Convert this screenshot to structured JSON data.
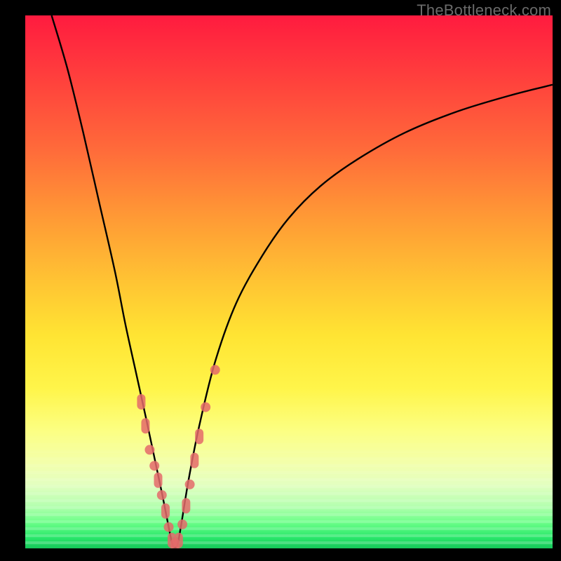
{
  "watermark": "TheBottleneck.com",
  "colors": {
    "background": "#000000",
    "curve": "#000000",
    "marker": "#e46a6a"
  },
  "chart_data": {
    "type": "line",
    "title": "",
    "xlabel": "",
    "ylabel": "",
    "xlim": [
      0,
      100
    ],
    "ylim": [
      0,
      100
    ],
    "grid": false,
    "legend": false,
    "series": [
      {
        "name": "bottleneck-curve",
        "x": [
          5,
          8,
          11,
          14,
          17,
          19,
          21,
          23,
          24.5,
          26,
          27.2,
          28,
          28.8,
          29.5,
          31,
          33,
          36,
          40,
          45,
          50,
          56,
          63,
          72,
          82,
          92,
          100
        ],
        "y": [
          100,
          90,
          78,
          65,
          52,
          42,
          33,
          24,
          17,
          10,
          4,
          0.5,
          0.5,
          4,
          13,
          23,
          35,
          46,
          55,
          62,
          68,
          73,
          78,
          82,
          85,
          87
        ]
      }
    ],
    "markers": [
      {
        "x": 22.0,
        "y": 27.5,
        "kind": "pill"
      },
      {
        "x": 22.8,
        "y": 23.0,
        "kind": "pill"
      },
      {
        "x": 23.6,
        "y": 18.5,
        "kind": "dot"
      },
      {
        "x": 24.5,
        "y": 15.5,
        "kind": "dot"
      },
      {
        "x": 25.2,
        "y": 12.8,
        "kind": "pill"
      },
      {
        "x": 25.9,
        "y": 10.0,
        "kind": "dot"
      },
      {
        "x": 26.6,
        "y": 7.0,
        "kind": "pill"
      },
      {
        "x": 27.2,
        "y": 4.0,
        "kind": "dot"
      },
      {
        "x": 27.8,
        "y": 1.5,
        "kind": "pill"
      },
      {
        "x": 28.4,
        "y": 0.5,
        "kind": "pill"
      },
      {
        "x": 29.1,
        "y": 1.5,
        "kind": "pill"
      },
      {
        "x": 29.8,
        "y": 4.5,
        "kind": "dot"
      },
      {
        "x": 30.5,
        "y": 8.0,
        "kind": "pill"
      },
      {
        "x": 31.2,
        "y": 12.0,
        "kind": "dot"
      },
      {
        "x": 32.1,
        "y": 16.5,
        "kind": "pill"
      },
      {
        "x": 33.0,
        "y": 21.0,
        "kind": "pill"
      },
      {
        "x": 34.2,
        "y": 26.5,
        "kind": "dot"
      },
      {
        "x": 36.0,
        "y": 33.5,
        "kind": "dot"
      }
    ],
    "notes": "y represents bottleneck percentage (0 = no bottleneck, 100 = full bottleneck); x is an unlabeled component-scale axis; values are estimated from the plotted curve since no numeric axes are drawn"
  }
}
